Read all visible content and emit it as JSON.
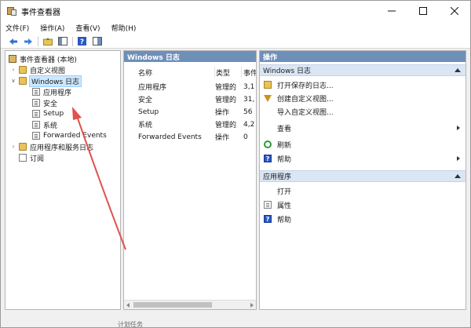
{
  "window": {
    "title": "事件查看器",
    "controls": [
      "minimize",
      "maximize",
      "close"
    ]
  },
  "menu": {
    "items": [
      "文件(F)",
      "操作(A)",
      "查看(V)",
      "帮助(H)"
    ]
  },
  "toolbar": {
    "icons": [
      "back-arrow-icon",
      "forward-arrow-icon",
      "folder-up-icon",
      "show-hide-tree-icon",
      "help-icon",
      "properties-icon"
    ]
  },
  "tree": {
    "root": "事件查看器 (本地)",
    "custom_views": "自定义视图",
    "windows_logs": "Windows 日志",
    "children": [
      "应用程序",
      "安全",
      "Setup",
      "系统",
      "Forwarded Events"
    ],
    "app_service_logs": "应用程序和服务日志",
    "subscriptions": "订阅"
  },
  "middle": {
    "header": "Windows 日志",
    "columns": [
      "名称",
      "类型",
      "事件"
    ],
    "rows": [
      {
        "name": "应用程序",
        "type": "管理的",
        "events": "3,1"
      },
      {
        "name": "安全",
        "type": "管理的",
        "events": "31,"
      },
      {
        "name": "Setup",
        "type": "操作",
        "events": "56"
      },
      {
        "name": "系统",
        "type": "管理的",
        "events": "4,2"
      },
      {
        "name": "Forwarded Events",
        "type": "操作",
        "events": "0"
      }
    ]
  },
  "actions": {
    "header": "操作",
    "section1": {
      "title": "Windows 日志",
      "items": [
        "打开保存的日志...",
        "创建自定义视图...",
        "导入自定义视图...",
        "查看",
        "刷新",
        "帮助"
      ]
    },
    "section2": {
      "title": "应用程序",
      "items": [
        "打开",
        "属性",
        "帮助"
      ]
    }
  },
  "bottom_peek": "计划任务",
  "colors": {
    "pane_header": "#6e8fb8",
    "section_bg": "#dbe6f4",
    "selection": "#cce8ff",
    "annotation_arrow": "#e0524a"
  }
}
